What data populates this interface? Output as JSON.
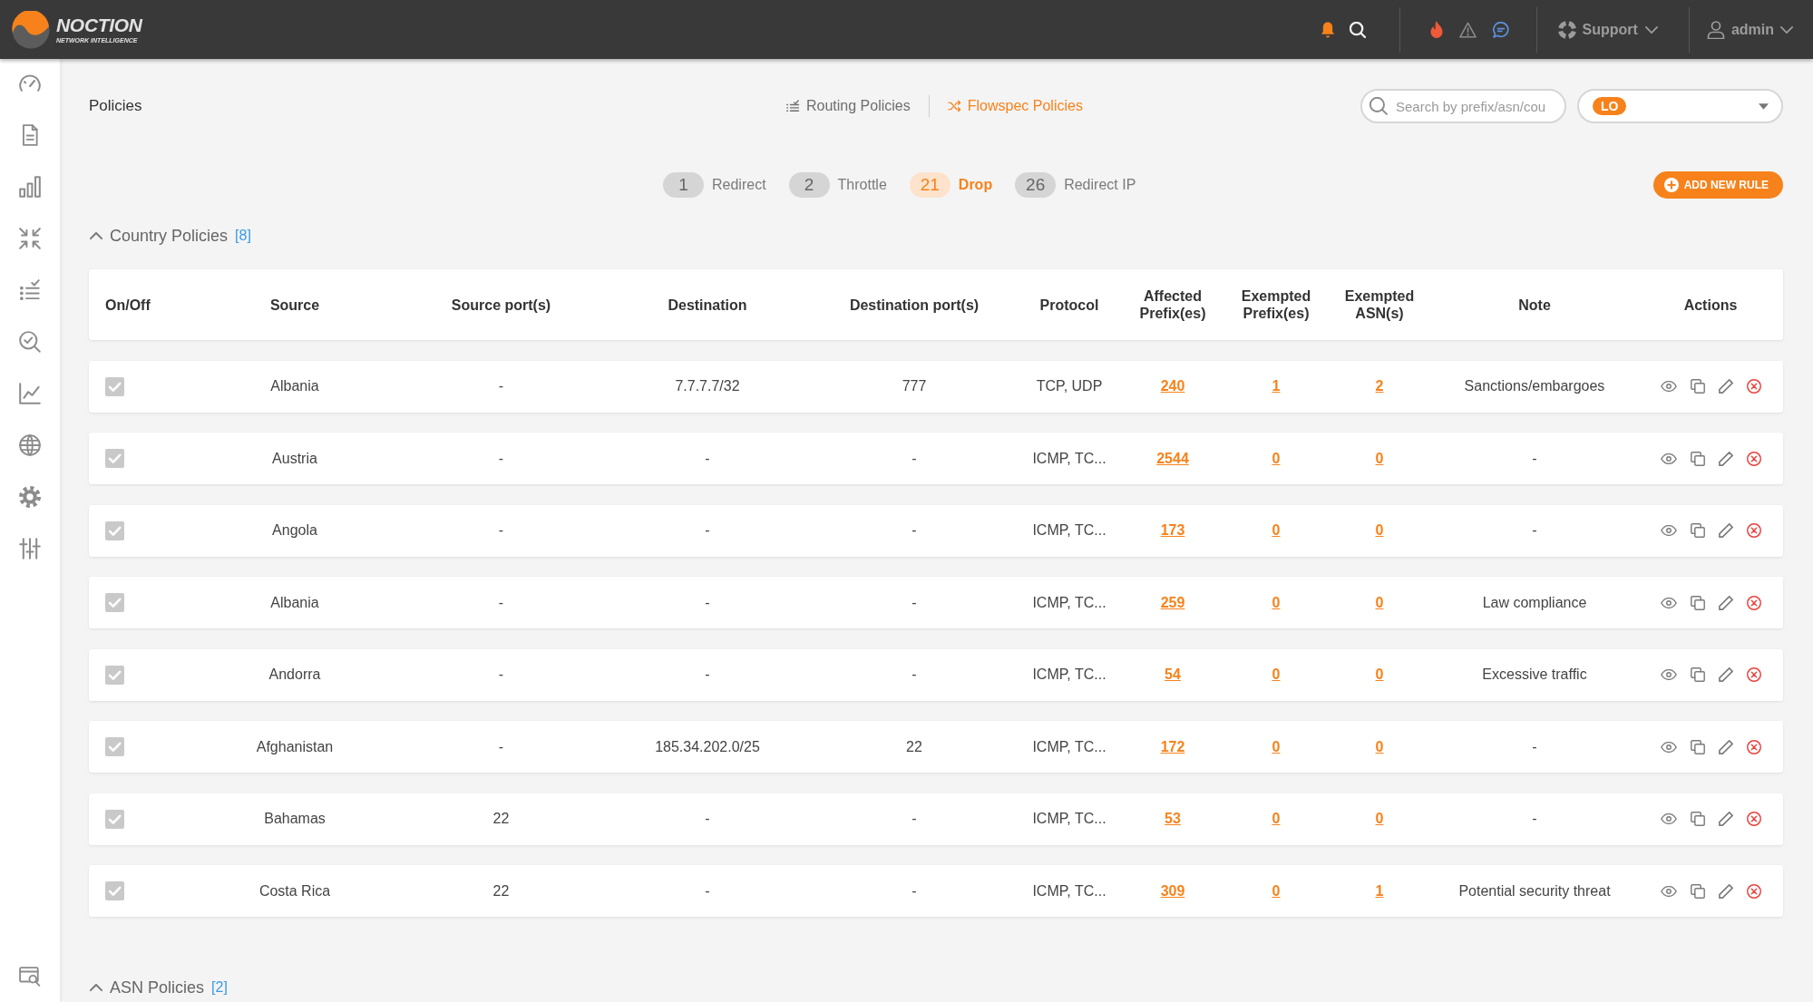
{
  "top_bar": {
    "brand_name": "NOCTION",
    "brand_tagline": "NETWORK INTELLIGENCE",
    "support_menu": "Support",
    "user_menu": "admin"
  },
  "page_title": "Policies",
  "policy_tabs": [
    {
      "label": "Routing Policies",
      "selected": false
    },
    {
      "label": "Flowspec Policies",
      "selected": true
    }
  ],
  "search": {
    "placeholder": "Search by prefix/asn/cou"
  },
  "instance_select": {
    "value": "LO"
  },
  "action_filters": [
    {
      "count": "1",
      "label": "Redirect",
      "selected": false
    },
    {
      "count": "2",
      "label": "Throttle",
      "selected": false
    },
    {
      "count": "21",
      "label": "Drop",
      "selected": true
    },
    {
      "count": "26",
      "label": "Redirect IP",
      "selected": false
    }
  ],
  "add_button": "ADD NEW RULE",
  "sections": [
    {
      "title": "Country Policies",
      "count": "[8]",
      "expanded": true,
      "table": {
        "columns": [
          "On/Off",
          "Source",
          "Source port(s)",
          "Destination",
          "Destination port(s)",
          "Protocol",
          "Affected Prefix(es)",
          "Exempted Prefix(es)",
          "Exempted ASN(s)",
          "Note",
          "Actions"
        ],
        "rows": [
          {
            "enabled": true,
            "source": "Albania",
            "source_ports": "-",
            "destination": "7.7.7.7/32",
            "destination_ports": "777",
            "protocol": "TCP, UDP",
            "affected_prefixes": "240",
            "exempted_prefixes": "1",
            "exempted_asns": "2",
            "note": "Sanctions/embargoes"
          },
          {
            "enabled": true,
            "source": "Austria",
            "source_ports": "-",
            "destination": "-",
            "destination_ports": "-",
            "protocol": "ICMP, TC...",
            "affected_prefixes": "2544",
            "exempted_prefixes": "0",
            "exempted_asns": "0",
            "note": "-"
          },
          {
            "enabled": true,
            "source": "Angola",
            "source_ports": "-",
            "destination": "-",
            "destination_ports": "-",
            "protocol": "ICMP, TC...",
            "affected_prefixes": "173",
            "exempted_prefixes": "0",
            "exempted_asns": "0",
            "note": "-"
          },
          {
            "enabled": true,
            "source": "Albania",
            "source_ports": "-",
            "destination": "-",
            "destination_ports": "-",
            "protocol": "ICMP, TC...",
            "affected_prefixes": "259",
            "exempted_prefixes": "0",
            "exempted_asns": "0",
            "note": "Law compliance"
          },
          {
            "enabled": true,
            "source": "Andorra",
            "source_ports": "-",
            "destination": "-",
            "destination_ports": "-",
            "protocol": "ICMP, TC...",
            "affected_prefixes": "54",
            "exempted_prefixes": "0",
            "exempted_asns": "0",
            "note": "Excessive traffic"
          },
          {
            "enabled": true,
            "source": "Afghanistan",
            "source_ports": "-",
            "destination": "185.34.202.0/25",
            "destination_ports": "22",
            "protocol": "ICMP, TC...",
            "affected_prefixes": "172",
            "exempted_prefixes": "0",
            "exempted_asns": "0",
            "note": "-"
          },
          {
            "enabled": true,
            "source": "Bahamas",
            "source_ports": "22",
            "destination": "-",
            "destination_ports": "-",
            "protocol": "ICMP, TC...",
            "affected_prefixes": "53",
            "exempted_prefixes": "0",
            "exempted_asns": "0",
            "note": "-"
          },
          {
            "enabled": true,
            "source": "Costa Rica",
            "source_ports": "22",
            "destination": "-",
            "destination_ports": "-",
            "protocol": "ICMP, TC...",
            "affected_prefixes": "309",
            "exempted_prefixes": "0",
            "exempted_asns": "1",
            "note": "Potential security threat"
          }
        ]
      }
    },
    {
      "title": "ASN Policies",
      "count": "[2]",
      "expanded": true
    }
  ]
}
